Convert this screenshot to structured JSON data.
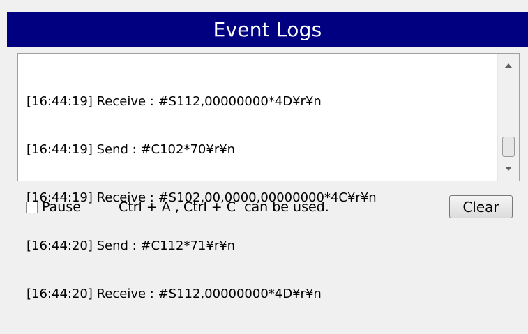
{
  "header": {
    "title": "Event Logs"
  },
  "log": {
    "lines": [
      "[16:44:19] Receive : #S112,00000000*4D¥r¥n",
      "[16:44:19] Send : #C102*70¥r¥n",
      "[16:44:19] Receive : #S102,00,0000,00000000*4C¥r¥n",
      "[16:44:20] Send : #C112*71¥r¥n",
      "[16:44:20] Receive : #S112,00000000*4D¥r¥n"
    ]
  },
  "controls": {
    "pause_label": "Pause",
    "pause_checked": false,
    "hint": "Ctrl + A , Ctrl + C  can be used.",
    "clear_label": "Clear"
  },
  "icons": {
    "scroll_up": "arrow-up-icon",
    "scroll_down": "arrow-down-icon"
  },
  "colors": {
    "header_bg": "#000080",
    "header_text": "#ffffff"
  }
}
